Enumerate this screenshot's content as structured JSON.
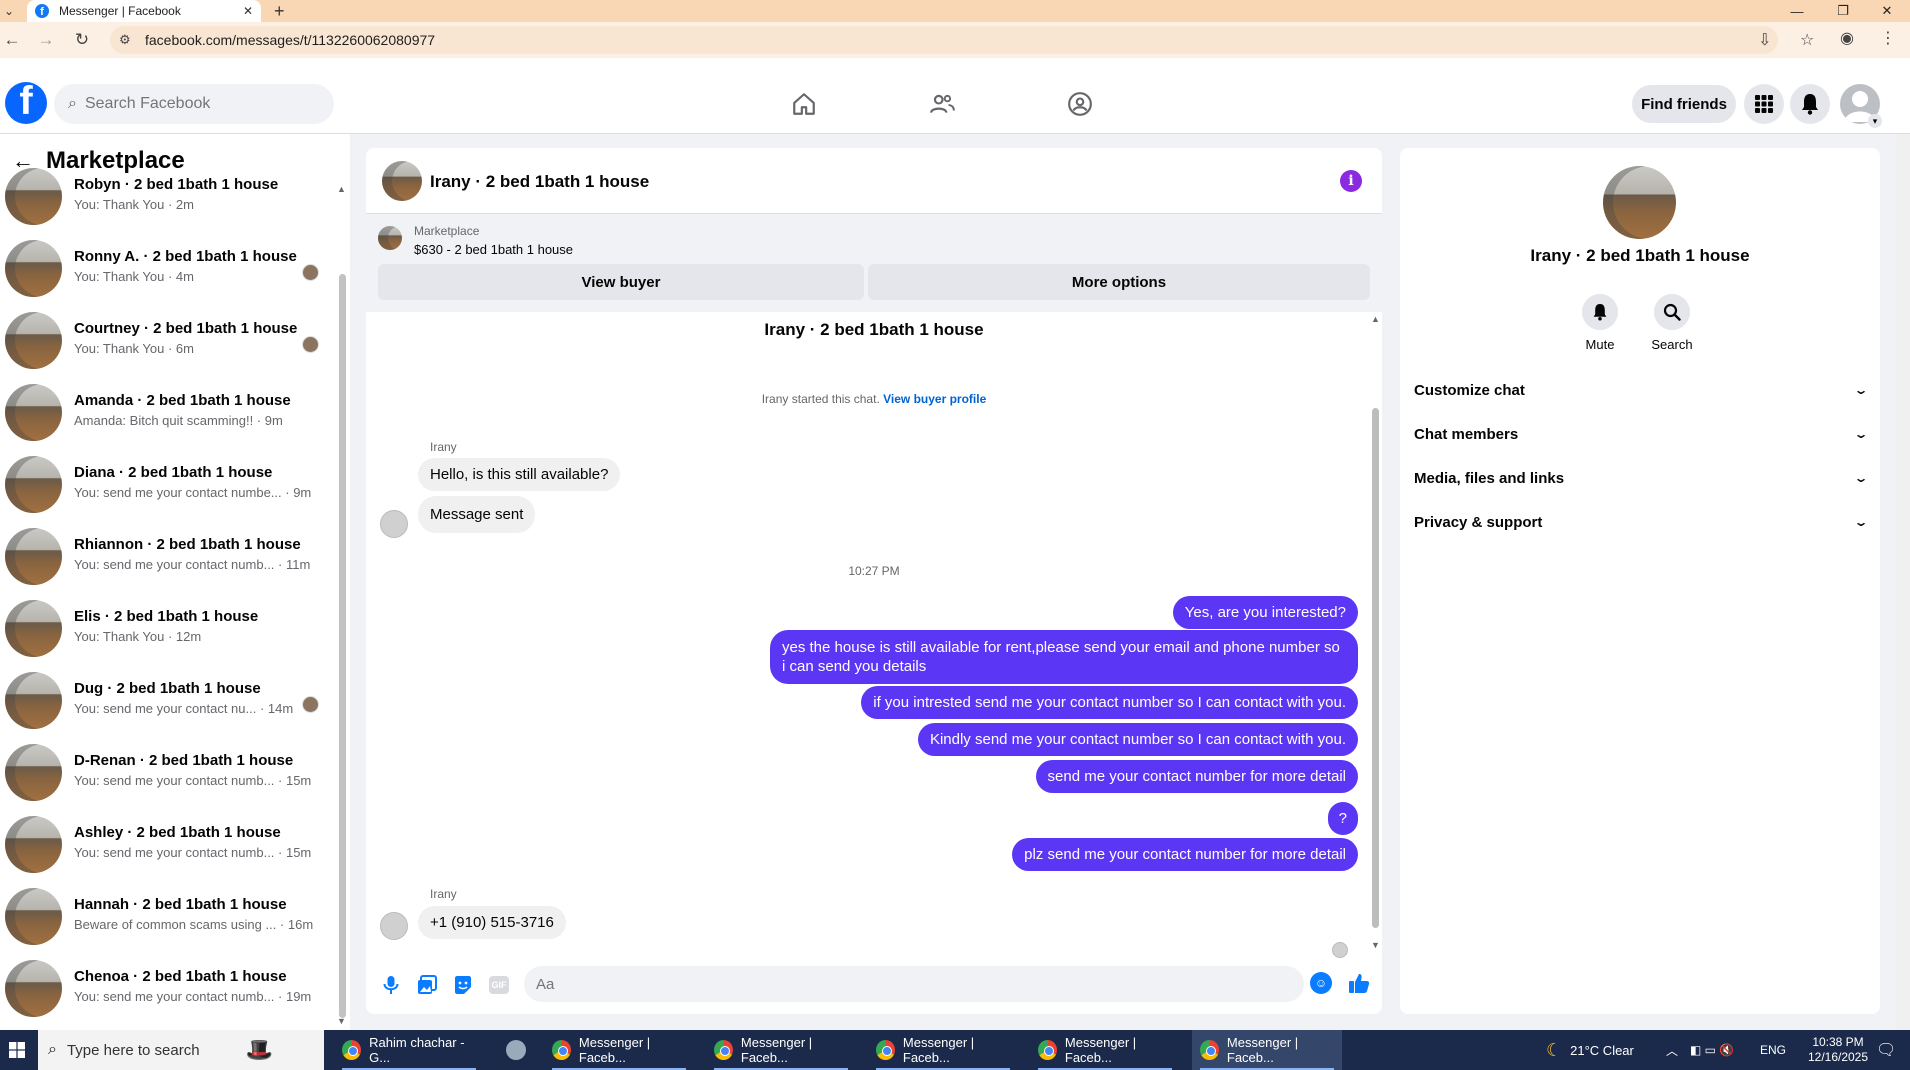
{
  "browser": {
    "tab_title": "Messenger | Facebook",
    "url": "facebook.com/messages/t/1132260062080977"
  },
  "header": {
    "search_placeholder": "Search Facebook",
    "find_friends": "Find friends"
  },
  "left": {
    "title": "Marketplace",
    "chats": [
      {
        "name": "Robyn · 2 bed 1bath 1 house",
        "sub": "You: Thank You · 2m",
        "seen": false
      },
      {
        "name": "Ronny A. · 2 bed 1bath 1 house",
        "sub": "You: Thank You · 4m",
        "seen": true
      },
      {
        "name": "Courtney · 2 bed 1bath 1 house",
        "sub": "You: Thank You · 6m",
        "seen": true
      },
      {
        "name": "Amanda · 2 bed 1bath 1 house",
        "sub": "Amanda: Bitch quit scamming!! · 9m",
        "seen": false
      },
      {
        "name": "Diana · 2 bed 1bath 1 house",
        "sub": "You: send me your contact numbe... · 9m",
        "seen": false
      },
      {
        "name": "Rhiannon · 2 bed 1bath 1 house",
        "sub": "You: send me your contact numb... · 11m",
        "seen": false
      },
      {
        "name": "Elis · 2 bed 1bath 1 house",
        "sub": "You: Thank You · 12m",
        "seen": false
      },
      {
        "name": "Dug · 2 bed 1bath 1 house",
        "sub": "You: send me your contact nu... · 14m",
        "seen": true
      },
      {
        "name": "D-Renan · 2 bed 1bath 1 house",
        "sub": "You: send me your contact numb... · 15m",
        "seen": false
      },
      {
        "name": "Ashley · 2 bed 1bath 1 house",
        "sub": "You: send me your contact numb... · 15m",
        "seen": false
      },
      {
        "name": "Hannah · 2 bed 1bath 1 house",
        "sub": "Beware of common scams using ... · 16m",
        "seen": false
      },
      {
        "name": "Chenoa · 2 bed 1bath 1 house",
        "sub": "You: send me your contact numb... · 19m",
        "seen": false
      }
    ]
  },
  "chat": {
    "title": "Irany · 2 bed 1bath 1 house",
    "marketplace_label": "Marketplace",
    "listing": "$630 - 2 bed 1bath 1 house",
    "view_buyer": "View buyer",
    "more_options": "More options",
    "started_text": "Irany started this chat.",
    "view_buyer_profile": "View buyer profile",
    "sender_name": "Irany",
    "incoming_1": "Hello, is this still available?",
    "incoming_2": "Message sent",
    "time_separator": "10:27 PM",
    "outgoing": [
      "Yes, are you interested?",
      "yes the house is still available for rent,please send your email and phone number so i can send you details",
      "if you intrested send me your contact number so I can contact with you.",
      "Kindly send me your contact number so I can contact with you.",
      "send me your contact number for more detail",
      "?",
      "plz send me your contact number for more detail"
    ],
    "incoming_3": "+1 (910) 515-3716",
    "composer_placeholder": "Aa"
  },
  "right": {
    "name": "Irany · 2 bed 1bath 1 house",
    "mute": "Mute",
    "search": "Search",
    "sections": [
      "Customize chat",
      "Chat members",
      "Media, files and links",
      "Privacy & support"
    ]
  },
  "taskbar": {
    "search_placeholder": "Type here to search",
    "apps": [
      "Rahim chachar - G...",
      "Messenger | Faceb...",
      "Messenger | Faceb...",
      "Messenger | Faceb...",
      "Messenger | Faceb...",
      "Messenger | Faceb..."
    ],
    "weather": "21°C  Clear",
    "lang": "ENG",
    "time": "10:38 PM",
    "date": "12/16/2025"
  },
  "colors": {
    "fb_blue": "#0866ff",
    "outgoing_bubble": "#5b36f5",
    "info_purple": "#8a2be2"
  }
}
